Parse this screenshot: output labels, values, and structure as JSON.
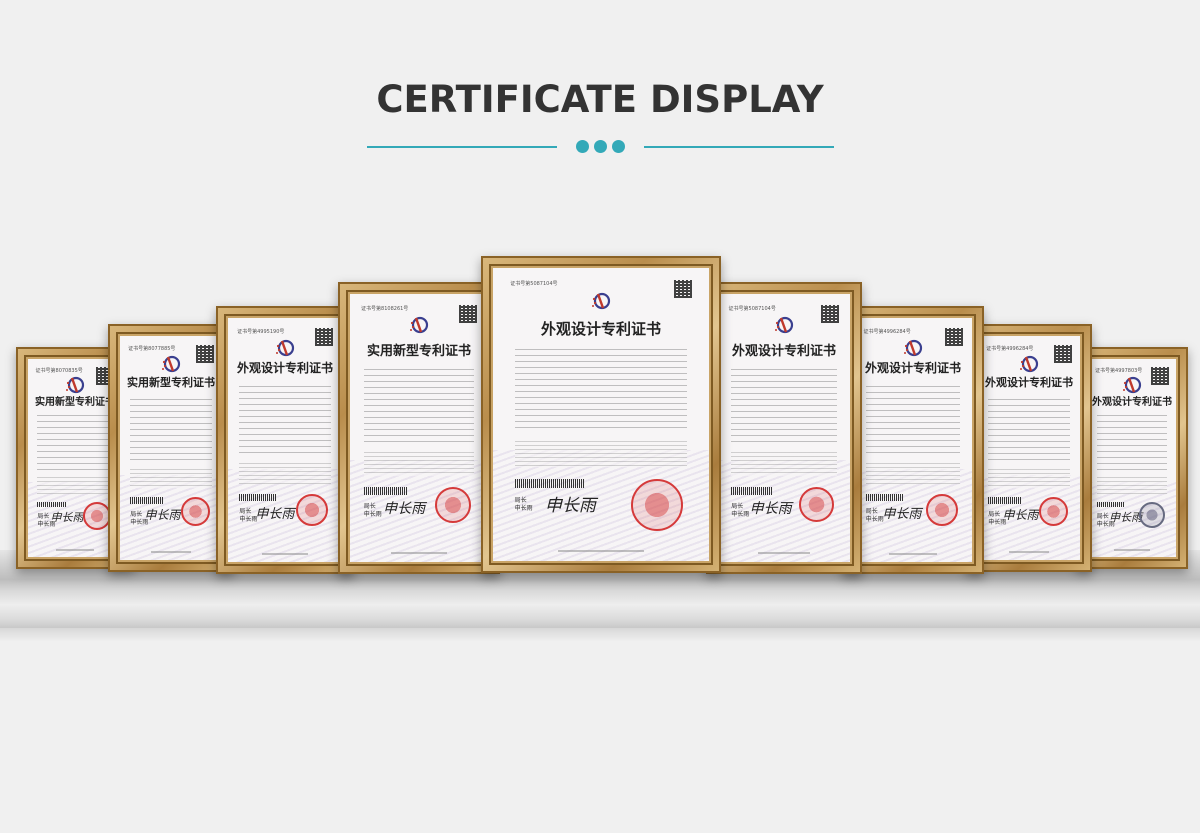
{
  "heading": "CERTIFICATE DISPLAY",
  "colors": {
    "accent": "#33a9b8",
    "heading": "#333333",
    "background": "#f0f0f0"
  },
  "certificates": [
    {
      "title": "实用新型专利证书",
      "serial": "证书号第8070835号",
      "signature": "申长雨",
      "sig_label": "局长\n申长雨",
      "seal": "red"
    },
    {
      "title": "实用新型专利证书",
      "serial": "证书号第8077885号",
      "signature": "申长雨",
      "sig_label": "局长\n申长雨",
      "seal": "red"
    },
    {
      "title": "外观设计专利证书",
      "serial": "证书号第4995190号",
      "signature": "申长雨",
      "sig_label": "局长\n申长雨",
      "seal": "red"
    },
    {
      "title": "实用新型专利证书",
      "serial": "证书号第8108261号",
      "signature": "申长雨",
      "sig_label": "局长\n申长雨",
      "seal": "red"
    },
    {
      "title": "外观设计专利证书",
      "serial": "证书号第5087104号",
      "signature": "申长雨",
      "sig_label": "局长\n申长雨",
      "seal": "red"
    },
    {
      "title": "外观设计专利证书",
      "serial": "证书号第5087104号",
      "signature": "申长雨",
      "sig_label": "局长\n申长雨",
      "seal": "red"
    },
    {
      "title": "外观设计专利证书",
      "serial": "证书号第4996284号",
      "signature": "申长雨",
      "sig_label": "局长\n申长雨",
      "seal": "red"
    },
    {
      "title": "外观设计专利证书",
      "serial": "证书号第4996284号",
      "signature": "申长雨",
      "sig_label": "局长\n申长雨",
      "seal": "red"
    },
    {
      "title": "外观设计专利证书",
      "serial": "证书号第4997803号",
      "signature": "申长雨",
      "sig_label": "局长\n申长雨",
      "seal": "gray"
    }
  ]
}
